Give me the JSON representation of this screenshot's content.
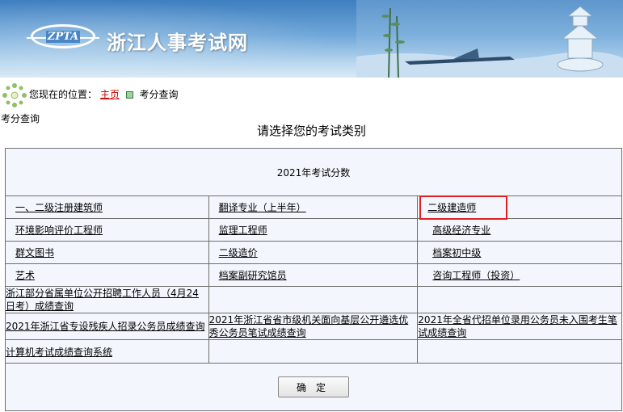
{
  "header": {
    "logo_text": "ZPTA",
    "site_title": "浙江人事考试网"
  },
  "breadcrumb": {
    "prefix": "您现在的位置：",
    "home": "主页",
    "current": "考分查询"
  },
  "page_subtitle": "考分查询",
  "prompt": "请选择您的考试类别",
  "table": {
    "year_title": "2021年考试分数",
    "grid": [
      [
        "一、二级注册建筑师",
        "翻译专业（上半年）",
        "二级建造师"
      ],
      [
        "环境影响评价工程师",
        "监理工程师",
        "高级经济专业"
      ],
      [
        "群文图书",
        "二级造价",
        "档案初中级"
      ],
      [
        "艺术",
        "档案副研究馆员",
        "咨询工程师（投资）"
      ]
    ],
    "extra_row1": [
      "浙江部分省属单位公开招聘工作人员（4月24日考）成绩查询",
      "",
      ""
    ],
    "extra_row2": [
      "2021年浙江省专设残疾人招录公务员成绩查询",
      "2021年浙江省省市级机关面向基层公开遴选优秀公务员笔试成绩查询",
      "2021年全省代招单位录用公务员未入围考生笔试成绩查询"
    ],
    "extra_row3": "计算机考试成绩查询系统",
    "confirm_button": "确定"
  },
  "highlight_color": "#e02020"
}
